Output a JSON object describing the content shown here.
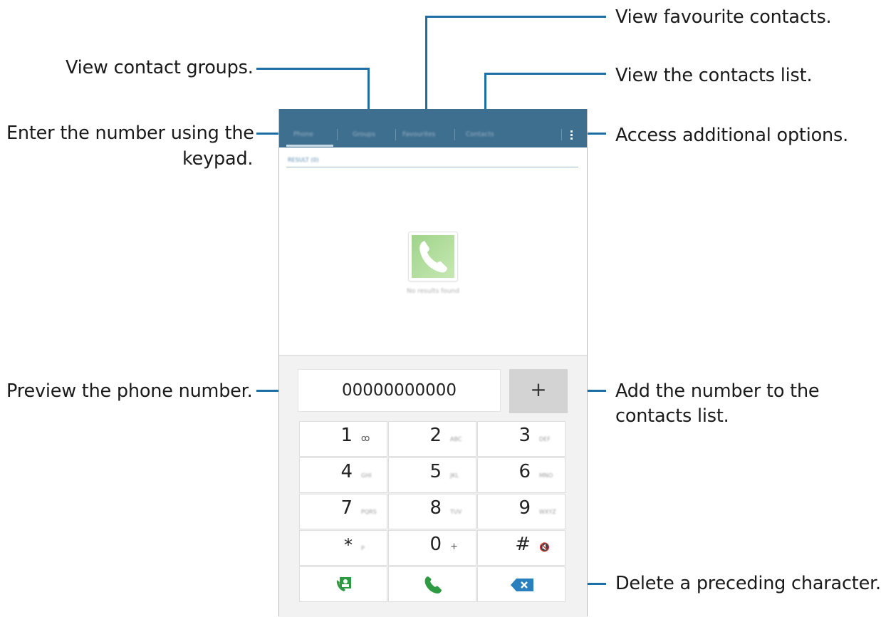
{
  "callouts": {
    "view_favourites": "View favourite contacts.",
    "view_groups": "View contact groups.",
    "view_contacts_list": "View the contacts list.",
    "enter_number_line1": "Enter the number using the",
    "enter_number_line2": "keypad.",
    "additional_options": "Access additional options.",
    "preview_number": "Preview the phone number.",
    "add_number_line1": "Add the number to the",
    "add_number_line2": "contacts list.",
    "delete_char": "Delete a preceding character."
  },
  "tabs": [
    {
      "label": "Phone",
      "selected": true
    },
    {
      "label": "Groups"
    },
    {
      "label": "Favourites"
    },
    {
      "label": "Contacts"
    }
  ],
  "results_header": "RESULT (0)",
  "empty_state": "No results found",
  "number_field": {
    "value": "00000000000"
  },
  "add_button": {
    "label": "+"
  },
  "keypad": [
    {
      "digit": "1",
      "letters": "ꝏ"
    },
    {
      "digit": "2",
      "letters": "ABC"
    },
    {
      "digit": "3",
      "letters": "DEF"
    },
    {
      "digit": "4",
      "letters": "GHI"
    },
    {
      "digit": "5",
      "letters": "JKL"
    },
    {
      "digit": "6",
      "letters": "MNO"
    },
    {
      "digit": "7",
      "letters": "PQRS"
    },
    {
      "digit": "8",
      "letters": "TUV"
    },
    {
      "digit": "9",
      "letters": "WXYZ"
    },
    {
      "digit": "*",
      "letters": "P"
    },
    {
      "digit": "0",
      "letters": "+"
    },
    {
      "digit": "#",
      "letters": "🔇"
    }
  ],
  "colors": {
    "accent_line": "#1d6fa5",
    "tab_bar": "#3f6f8f",
    "call_green": "#2f9a44",
    "delete_blue": "#2a7fbf"
  }
}
